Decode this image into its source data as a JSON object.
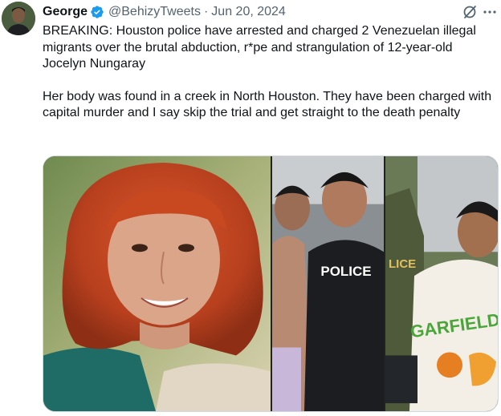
{
  "tweet": {
    "display_name": "George",
    "handle": "@BehizyTweets",
    "separator": "·",
    "date": "Jun 20, 2024",
    "paragraphs": [
      "BREAKING: Houston police have arrested and charged 2 Venezuelan illegal migrants over the brutal abduction, r*pe and strangulation of 12-year-old Jocelyn Nungaray",
      "Her body was found in a creek in North Houston. They have been charged with capital murder and I say skip the trial and get straight to the death penalty"
    ]
  },
  "photos": {
    "police_vest_text": "POLICE",
    "shirt_text": "GARFIELD"
  },
  "icons": {
    "verified": "verified-badge-icon",
    "grok": "grok-icon",
    "more": "more-icon"
  },
  "colors": {
    "text_primary": "#0f1419",
    "text_secondary": "#536471",
    "verified_blue": "#1d9bf0",
    "border": "#cfd9de"
  }
}
